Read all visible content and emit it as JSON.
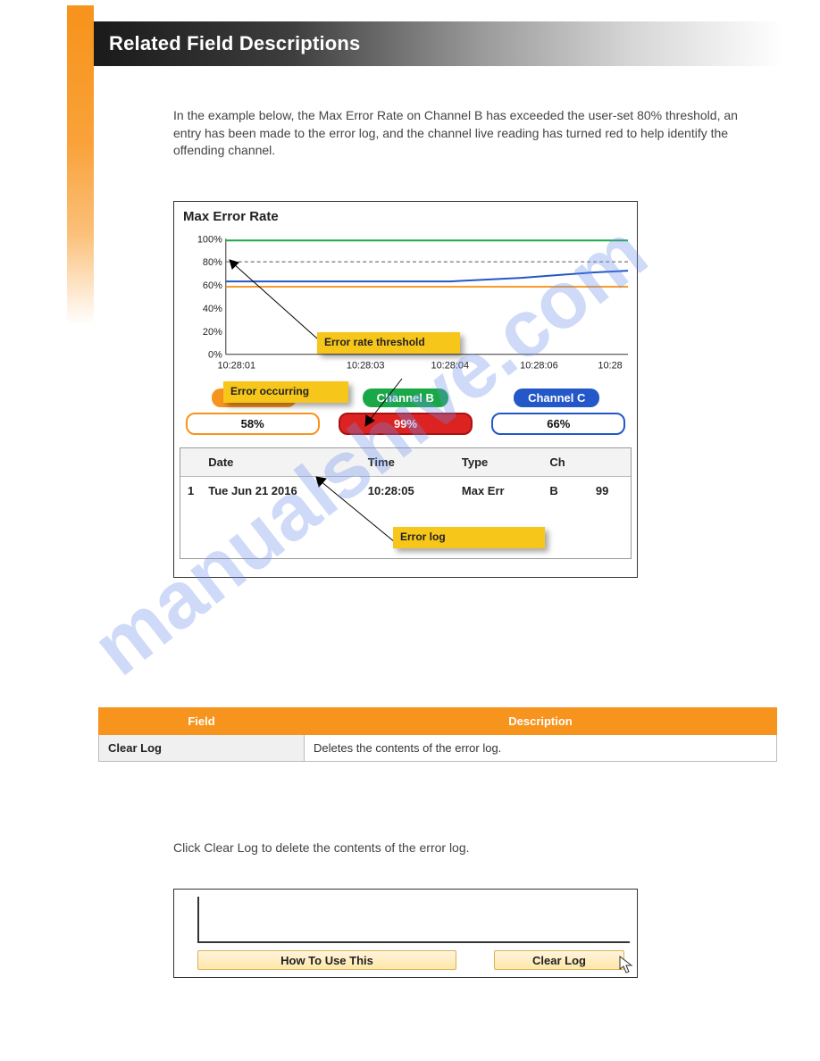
{
  "header": {
    "title": "Related Field Descriptions"
  },
  "paras": {
    "p1": "In the example below, the Max Error Rate on Channel B has exceeded the user-set 80% threshold, an entry has been made to the error log, and the channel live reading has turned red to help identify the offending channel.",
    "p2": "",
    "p3": "Click Clear Log to delete the contents of the error log."
  },
  "chart_data": {
    "type": "line",
    "title": "Max Error Rate",
    "x": [
      "10:28:01",
      "10:28:03",
      "10:28:04",
      "10:28:06",
      "10:28"
    ],
    "ylim": [
      0,
      100
    ],
    "yticks": [
      0,
      20,
      40,
      60,
      80,
      100
    ],
    "threshold": 80,
    "series": [
      {
        "name": "Channel A",
        "color": "#f7941d",
        "values": [
          58,
          58,
          58,
          58,
          58
        ]
      },
      {
        "name": "Channel B",
        "color": "#1aa846",
        "values": [
          99,
          99,
          99,
          99,
          99
        ]
      },
      {
        "name": "Channel C",
        "color": "#2457c7",
        "values": [
          63,
          63,
          63,
          65,
          68
        ]
      }
    ]
  },
  "annotations": {
    "a_threshold": "Error rate threshold",
    "a_error": "Error occurring",
    "a_log": "Error log"
  },
  "channels": {
    "a": {
      "label": "Channel A",
      "pct": "58%"
    },
    "b": {
      "label": "Channel B",
      "pct": "99%"
    },
    "c": {
      "label": "Channel C",
      "pct": "66%"
    }
  },
  "log": {
    "headers": {
      "row": "",
      "date": "Date",
      "time": "Time",
      "type": "Type",
      "ch": "Ch",
      "val": ""
    },
    "rows": [
      {
        "n": "1",
        "date": "Tue Jun 21 2016",
        "time": "10:28:05",
        "type": "Max Err",
        "ch": "B",
        "val": "99"
      }
    ]
  },
  "table": {
    "h1": "Field",
    "h2": "Description",
    "rows": [
      {
        "k": "Clear Log",
        "v": "Deletes the contents of the error log."
      }
    ]
  },
  "buttons": {
    "how": "How To Use This",
    "clear": "Clear Log"
  },
  "watermark": "manualshive.com"
}
